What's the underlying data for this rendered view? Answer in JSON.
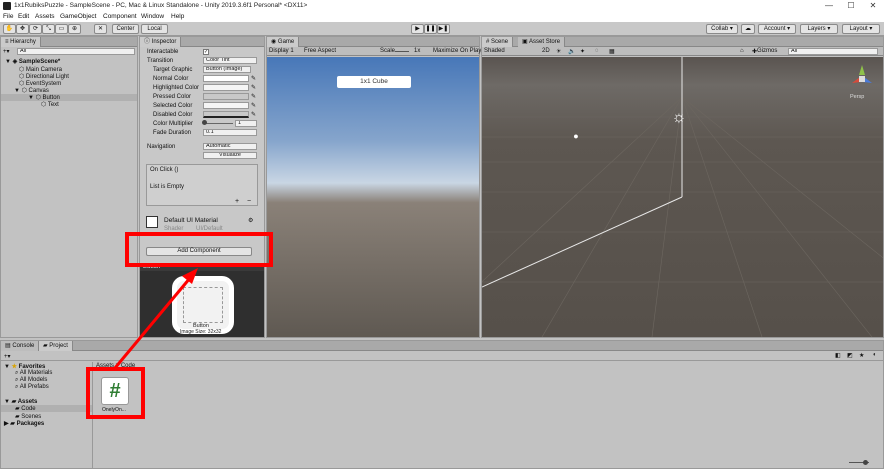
{
  "window": {
    "title": "1x1RubiksPuzzle - SampleScene - PC, Mac & Linux Standalone - Unity 2019.3.6f1 Personal* <DX11>",
    "controls": [
      "—",
      "☐",
      "✕"
    ]
  },
  "menu": [
    "File",
    "Edit",
    "Assets",
    "GameObject",
    "Component",
    "Window",
    "Help"
  ],
  "toolbar": {
    "pivot": "Center",
    "space": "Local",
    "collab": "Collab ▾",
    "account": "Account ▾",
    "layers": "Layers ▾",
    "layout": "Layout ▾"
  },
  "hierarchy": {
    "tab": "Hierarchy",
    "search_placeholder": "All",
    "items": [
      {
        "label": "SampleScene*",
        "indent": 0
      },
      {
        "label": "Main Camera",
        "indent": 1
      },
      {
        "label": "Directional Light",
        "indent": 1
      },
      {
        "label": "EventSystem",
        "indent": 1
      },
      {
        "label": "Canvas",
        "indent": 1
      },
      {
        "label": "Button",
        "indent": 2
      },
      {
        "label": "Text",
        "indent": 3
      }
    ]
  },
  "inspector": {
    "tab": "Inspector",
    "interactable_label": "Interactable",
    "transition_label": "Transition",
    "transition_value": "Color Tint",
    "target_graphic_label": "Target Graphic",
    "target_graphic_value": "Button (Image)",
    "normal_color_label": "Normal Color",
    "highlighted_color_label": "Highlighted Color",
    "pressed_color_label": "Pressed Color",
    "selected_color_label": "Selected Color",
    "disabled_color_label": "Disabled Color",
    "color_multiplier_label": "Color Multiplier",
    "color_multiplier_value": "1",
    "fade_duration_label": "Fade Duration",
    "fade_duration_value": "0.1",
    "navigation_label": "Navigation",
    "navigation_value": "Automatic",
    "visualize_label": "Visualize",
    "onclick_label": "On Click ()",
    "list_empty": "List is Empty",
    "material_name": "Default UI Material",
    "shader_label": "Shader",
    "shader_value": "UI/Default",
    "add_component": "Add Component",
    "preview_label": "Button",
    "preview_caption": "Button",
    "preview_size": "Image Size: 32x32"
  },
  "game": {
    "tab": "Game",
    "display": "Display 1",
    "aspect": "Free Aspect",
    "scale_label": "Scale",
    "scale_value": "1x",
    "maximize": "Maximize On Play",
    "button_text": "1x1 Cube"
  },
  "scene": {
    "tab": "Scene",
    "asset_store_tab": "Asset Store",
    "shading": "Shaded",
    "mode_2d": "2D",
    "gizmos": "Gizmos",
    "search_placeholder": "All",
    "persp": "Persp"
  },
  "project": {
    "console_tab": "Console",
    "project_tab": "Project",
    "breadcrumb": "Assets > Code",
    "favorites": {
      "label": "Favorites",
      "items": [
        "All Materials",
        "All Models",
        "All Prefabs"
      ]
    },
    "assets": {
      "label": "Assets",
      "items": [
        "Code",
        "Scenes"
      ]
    },
    "packages": "Packages",
    "file_name": "OnelyOn..."
  },
  "colors": {
    "highlight": "#ff0000",
    "selection": "#3e6dbd"
  }
}
